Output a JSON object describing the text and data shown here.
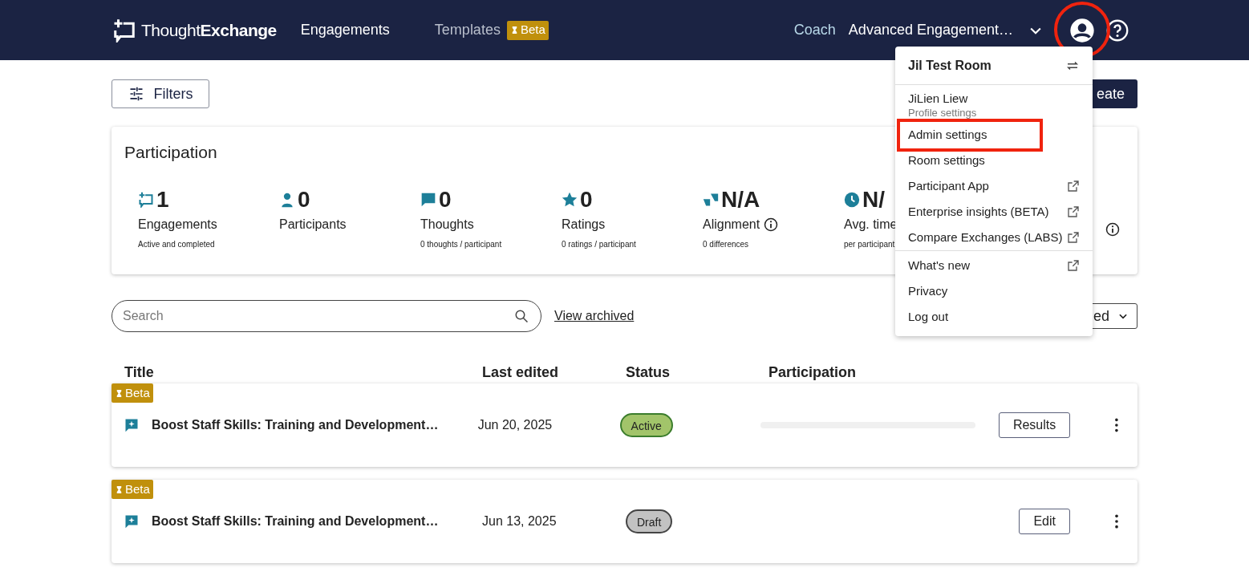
{
  "header": {
    "logo": "Thought**Exchange**",
    "nav": [
      {
        "label": "Engagements",
        "selected": true
      },
      {
        "label": "Templates",
        "selected": false,
        "badge": "Beta"
      }
    ],
    "coach": "Coach",
    "room_picker": "Advanced Engagement…",
    "account_circled": true
  },
  "toolbar": {
    "filters": "Filters",
    "create": "eate"
  },
  "participation": {
    "title": "Participation",
    "stats": [
      {
        "kind": "engagements",
        "value": "1",
        "label": "Engagements",
        "note": "Active and completed",
        "info": false
      },
      {
        "kind": "participants",
        "value": "0",
        "label": "Participants",
        "info": false
      },
      {
        "kind": "thoughts",
        "value": "0",
        "label": "Thoughts",
        "note": "0 thoughts / participant",
        "info": false
      },
      {
        "kind": "ratings",
        "value": "0",
        "label": "Ratings",
        "note": "0 ratings / participant",
        "info": false
      },
      {
        "kind": "alignment",
        "value": "N/A",
        "label": "Alignment",
        "note": "0 differences",
        "info": true
      },
      {
        "kind": "time",
        "value": "N/",
        "label": "Avg. time",
        "note": "per participant",
        "info": false
      },
      {
        "kind": "hidden",
        "info": true
      }
    ]
  },
  "search": {
    "placeholder": "Search",
    "link": "View archived",
    "sort": "ed"
  },
  "table": {
    "columns": [
      "Title",
      "Last edited",
      "Status",
      "Participation"
    ],
    "rows": [
      {
        "badge": "Beta",
        "title": "Boost Staff Skills: Training and Development…",
        "last_edited": "Jun 20, 2025",
        "status": {
          "label": "Active",
          "kind": "active"
        },
        "participation": {
          "level": 0
        },
        "action": "Results"
      },
      {
        "badge": "Beta",
        "title": "Boost Staff Skills: Training and Development…",
        "last_edited": "Jun 13, 2025",
        "status": {
          "label": "Draft",
          "kind": "draft"
        },
        "action": "Edit"
      }
    ]
  },
  "account_menu": {
    "room": "Jil Test Room",
    "groups": [
      [
        {
          "label": "JiLien Liew",
          "sublabel": "Profile settings",
          "external": false,
          "highlighted": false
        },
        {
          "label": "Admin settings",
          "external": false,
          "highlighted": true
        },
        {
          "label": "Room settings",
          "external": false,
          "highlighted": false
        },
        {
          "label": "Participant App",
          "external": true,
          "highlighted": false
        },
        {
          "label": "Enterprise insights (BETA)",
          "external": true,
          "highlighted": false
        },
        {
          "label": "Compare Exchanges (LABS)",
          "external": true,
          "highlighted": false
        }
      ],
      [
        {
          "label": "What's new",
          "external": true,
          "highlighted": false
        },
        {
          "label": "Privacy",
          "external": false,
          "highlighted": false
        },
        {
          "label": "Log out",
          "external": false,
          "highlighted": false
        }
      ]
    ]
  }
}
